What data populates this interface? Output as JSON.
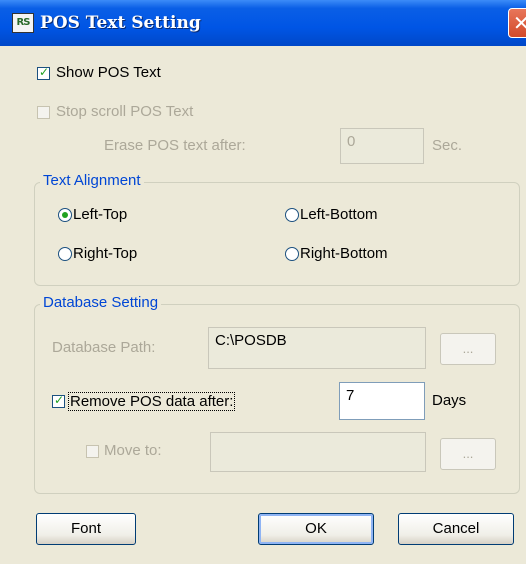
{
  "window": {
    "title": "POS Text Setting",
    "icon_text": "RS"
  },
  "pos_text": {
    "show_label": "Show POS Text",
    "show_checked": true,
    "stop_scroll_label": "Stop scroll POS Text",
    "stop_scroll_checked": false,
    "erase_label": "Erase POS text after:",
    "erase_value": "0",
    "erase_unit": "Sec."
  },
  "alignment": {
    "title": "Text Alignment",
    "options": [
      "Left-Top",
      "Left-Bottom",
      "Right-Top",
      "Right-Bottom"
    ],
    "selected": "Left-Top"
  },
  "database": {
    "title": "Database Setting",
    "path_label": "Database Path:",
    "path_value": "C:\\POSDB",
    "browse_label": "...",
    "remove_label": "Remove POS data after:",
    "remove_checked": true,
    "remove_value": "7",
    "remove_unit": "Days",
    "move_label": "Move to:",
    "move_checked": false,
    "move_value": ""
  },
  "buttons": {
    "font": "Font",
    "ok": "OK",
    "cancel": "Cancel"
  }
}
